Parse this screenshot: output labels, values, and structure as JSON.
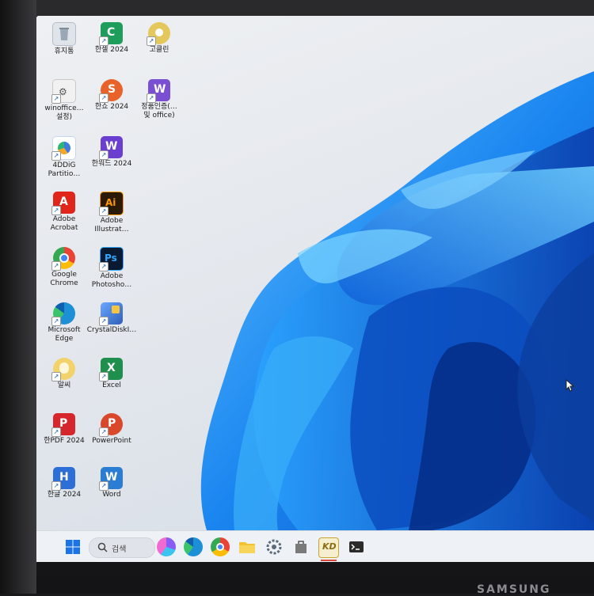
{
  "desktop": {
    "icons": [
      {
        "label": "휴지통",
        "icon": "recycle-bin-icon",
        "color": "#9aa7b4"
      },
      {
        "label": "한셀 2024",
        "icon": "hancell-icon",
        "color": "#1e9e5a"
      },
      {
        "label": "고클린",
        "icon": "goclean-icon",
        "color": "#e5c85b"
      },
      {
        "label": "winoffice…\n설정)",
        "icon": "settings-shortcut-icon",
        "color": "#e6e6e6"
      },
      {
        "label": "한쇼 2024",
        "icon": "hanshow-icon",
        "color": "#e8622a"
      },
      {
        "label": "정품인증(…\n및 office)",
        "icon": "activation-icon",
        "color": "#7a4fd1"
      },
      {
        "label": "4DDiG\nPartitio…",
        "icon": "4ddig-icon",
        "color": "#3e7be0"
      },
      {
        "label": "한워드 2024",
        "icon": "hanword-icon",
        "color": "#6a3fcf"
      },
      {
        "label": "Adobe\nAcrobat",
        "icon": "acrobat-icon",
        "color": "#e0261b"
      },
      {
        "label": "Adobe\nIllustrat…",
        "icon": "illustrator-icon",
        "color": "#2b1a05"
      },
      {
        "label": "Google\nChrome",
        "icon": "chrome-icon",
        "color": "#4285f4"
      },
      {
        "label": "Adobe\nPhotosho…",
        "icon": "photoshop-icon",
        "color": "#0b1a33"
      },
      {
        "label": "Microsoft\nEdge",
        "icon": "edge-icon",
        "color": "#1d8fd6"
      },
      {
        "label": "CrystalDiskI…",
        "icon": "crystaldisk-icon",
        "color": "#3c74c9"
      },
      {
        "label": "알씨",
        "icon": "alsee-icon",
        "color": "#f2d36b"
      },
      {
        "label": "Excel",
        "icon": "excel-icon",
        "color": "#1f8f4e"
      },
      {
        "label": "한PDF 2024",
        "icon": "hanpdf-icon",
        "color": "#d4262b"
      },
      {
        "label": "PowerPoint",
        "icon": "powerpoint-icon",
        "color": "#d9482b"
      },
      {
        "label": "한글 2024",
        "icon": "hangul-icon",
        "color": "#2d6fd6"
      },
      {
        "label": "Word",
        "icon": "word-icon",
        "color": "#2b7cd3"
      }
    ]
  },
  "taskbar": {
    "search_label": "검색",
    "items": [
      {
        "icon": "windows-start-icon",
        "color": "#1a73e8"
      },
      {
        "icon": "copilot-icon",
        "color": "#8a5cf6"
      },
      {
        "icon": "edge-icon",
        "color": "#1d8fd6"
      },
      {
        "icon": "chrome-icon",
        "color": "#4285f4"
      },
      {
        "icon": "file-explorer-icon",
        "color": "#f2c230"
      },
      {
        "icon": "settings-icon",
        "color": "#5b6b7a"
      },
      {
        "icon": "store-bag-icon",
        "color": "#6b6b6b"
      },
      {
        "icon": "kd-app-icon",
        "color": "#c8a530",
        "label": "KD"
      },
      {
        "icon": "terminal-icon",
        "color": "#2b2b2b"
      }
    ]
  },
  "monitor": {
    "brand": "SAMSUNG"
  }
}
